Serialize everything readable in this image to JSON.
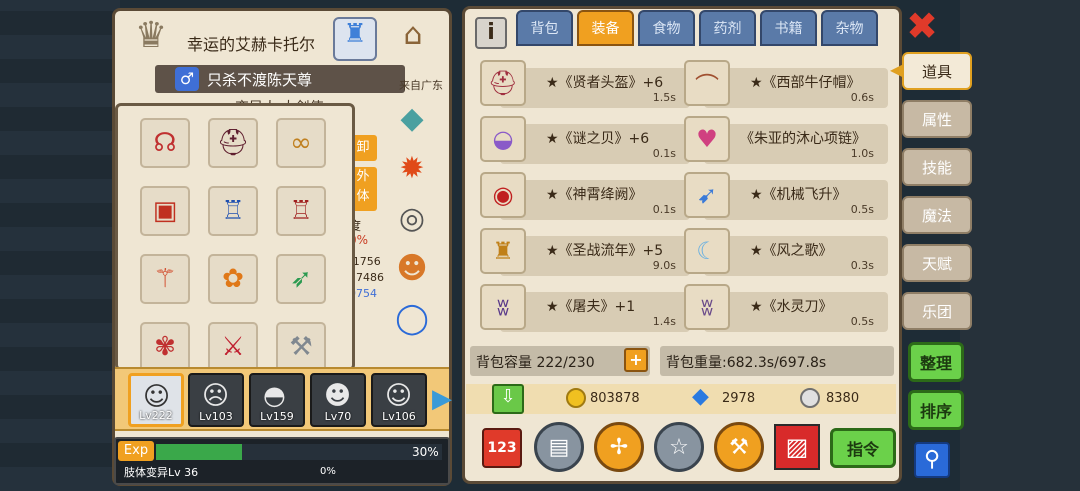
{
  "character": {
    "name": "幸运的艾赫卡托尔",
    "guild": "只杀不渡陈天尊",
    "origin": "来自广东",
    "class_partial": "变异人 大剑使",
    "gender_symbol": "♂"
  },
  "partial_stats": {
    "btn1": "卸",
    "btn2a": "外",
    "btn2b": "体",
    "label": "度",
    "pct": "0%",
    "v1": "/1756",
    "v2": "27486",
    "v3": "0754"
  },
  "equip_icons": [
    "headphones-icon",
    "helmet-icon",
    "scarf-icon",
    "backpack-icon",
    "vest-icon",
    "coat-icon",
    "scepter-icon",
    "pumpkin-staff-icon",
    "crossbow-icon",
    "flower-spear-icon",
    "red-axe-icon",
    "battle-axe-icon"
  ],
  "tabs": [
    "背包",
    "装备",
    "食物",
    "药剂",
    "书籍",
    "杂物"
  ],
  "active_tab": "装备",
  "items": [
    {
      "name": "★《贤者头盔》+6",
      "time": "1.5s",
      "icon": "helmet-icon"
    },
    {
      "name": "★《西部牛仔帽》",
      "time": "0.6s",
      "icon": "cowboy-hat-icon"
    },
    {
      "name": "★《谜之贝》+6",
      "time": "0.1s",
      "icon": "shell-icon"
    },
    {
      "name": "《朱亚的沐心项链》",
      "time": "1.0s",
      "icon": "necklace-icon"
    },
    {
      "name": "★《神霄绛阙》",
      "time": "0.1s",
      "icon": "amulet-icon"
    },
    {
      "name": "★《机械飞升》",
      "time": "0.5s",
      "icon": "wing-icon"
    },
    {
      "name": "★《圣战流年》+5",
      "time": "9.0s",
      "icon": "armor-icon"
    },
    {
      "name": "★《风之歌》",
      "time": "0.3s",
      "icon": "wind-blade-icon"
    },
    {
      "name": "★《屠夫》+1",
      "time": "1.4s",
      "icon": "claw-icon"
    },
    {
      "name": "★《水灵刀》",
      "time": "0.5s",
      "icon": "water-blade-icon"
    }
  ],
  "capacity": "背包容量 222/230",
  "weight": "背包重量:682.3s/697.8s",
  "currency": {
    "gold": "803878",
    "diamond": "2978",
    "silver": "8380"
  },
  "side_menu": [
    "道具",
    "属性",
    "技能",
    "魔法",
    "天赋",
    "乐团"
  ],
  "actions": {
    "sort1": "整理",
    "sort2": "排序",
    "command": "指令"
  },
  "party": [
    {
      "lv": "Lv222"
    },
    {
      "lv": "Lv103"
    },
    {
      "lv": "Lv159"
    },
    {
      "lv": "Lv70"
    },
    {
      "lv": "Lv106"
    }
  ],
  "exp": {
    "label": "Exp",
    "pct": "30%",
    "fill": 0.3,
    "sub_label": "肢体变异Lv 36",
    "sub_pct": "0%"
  },
  "colors": {
    "active_tab": "#f0a020",
    "inactive_tab": "#5a7aa8",
    "green": "#6bd14a",
    "close": "#e03a2a",
    "panel": "#efe6d3"
  }
}
